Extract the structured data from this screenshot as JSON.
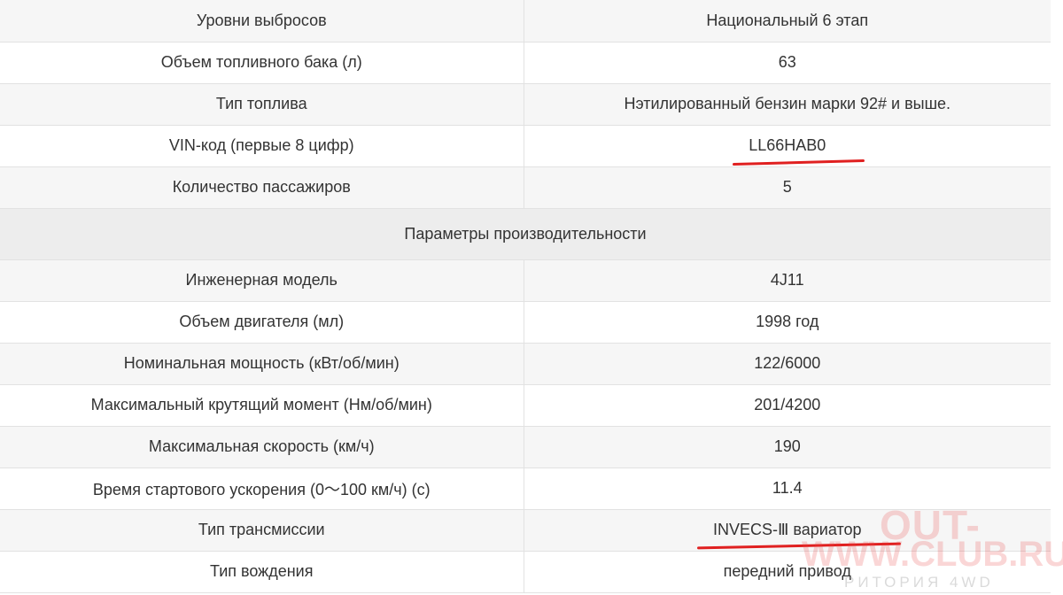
{
  "rows_top": [
    {
      "name": "Уровни выбросов",
      "value": "Национальный 6 этап"
    },
    {
      "name": "Объем топливного бака (л)",
      "value": "63"
    },
    {
      "name": "Тип топлива",
      "value": "Нэтилированный бензин марки 92# и выше."
    },
    {
      "name": "VIN-код (первые 8 цифр)",
      "value": "LL66HAB0"
    },
    {
      "name": "Количество пассажиров",
      "value": "5"
    }
  ],
  "section_title": "Параметры производительности",
  "rows_bottom": [
    {
      "name": "Инженерная модель",
      "value": "4J11"
    },
    {
      "name": "Объем двигателя (мл)",
      "value": "1998 год"
    },
    {
      "name": "Номинальная мощность (кВт/об/мин)",
      "value": "122/6000"
    },
    {
      "name": "Максимальный крутящий момент (Нм/об/мин)",
      "value": "201/4200"
    },
    {
      "name": "Максимальная скорость (км/ч)",
      "value": "190"
    },
    {
      "name": "Время стартового ускорения (0～100 км/ч) (с)",
      "value": "11.4"
    },
    {
      "name": "Тип трансмиссии",
      "value": "INVECS-Ⅲ вариатор"
    },
    {
      "name": "Тип вождения",
      "value": "передний привод"
    }
  ],
  "watermark": {
    "line1": "OUT-",
    "line2": "WWW.CLUB.RU",
    "line3": "РИТОРИЯ 4WD"
  },
  "colors": {
    "underline": "#e02020",
    "stripe": "#f6f6f6",
    "section_bg": "#ededed",
    "border": "#e2e2e2"
  }
}
